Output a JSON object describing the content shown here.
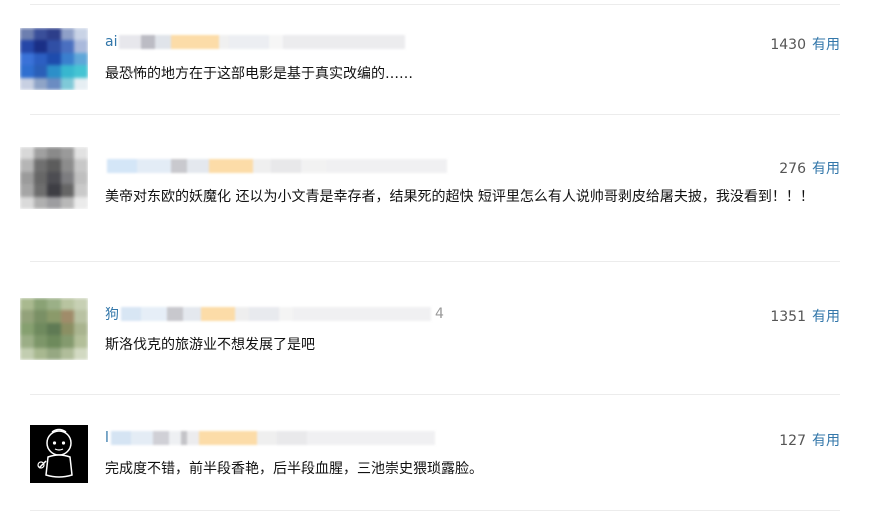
{
  "comments": [
    {
      "user": "ai",
      "user_trail": "",
      "votes": "1430",
      "useful_label": "有用",
      "text": "最恐怖的地方在于这部电影是基于真实改编的……"
    },
    {
      "user": "",
      "user_trail": "",
      "votes": "276",
      "useful_label": "有用",
      "text": "美帝对东欧的妖魔化 还以为小文青是幸存者，结果死的超快 短评里怎么有人说帅哥剥皮给屠夫披，我没看到！！！"
    },
    {
      "user": "狗",
      "user_trail": "4",
      "votes": "1351",
      "useful_label": "有用",
      "text": "斯洛伐克的旅游业不想发展了是吧"
    },
    {
      "user": "l",
      "user_trail": "",
      "votes": "127",
      "useful_label": "有用",
      "text": "完成度不错，前半段香艳，后半段血腥，三池崇史猥琐露脸。"
    }
  ]
}
